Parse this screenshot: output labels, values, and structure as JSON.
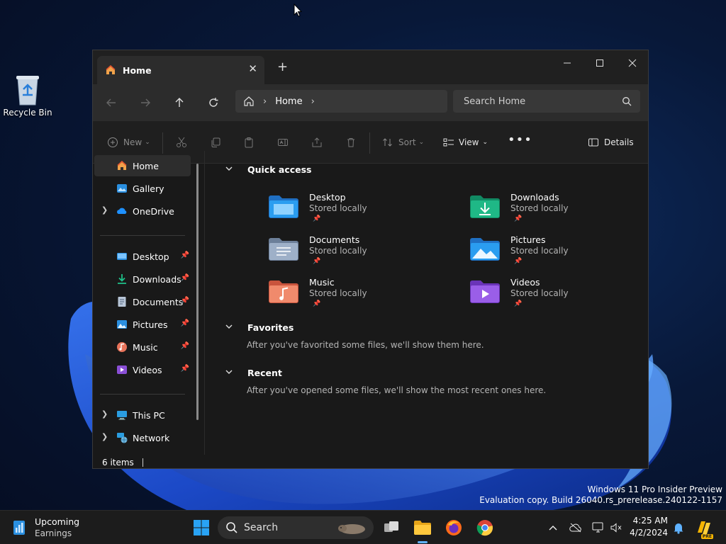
{
  "desktop": {
    "recycle_bin_label": "Recycle Bin",
    "watermark_line1": "Windows 11 Pro Insider Preview",
    "watermark_line2": "Evaluation copy. Build 26040.rs_prerelease.240122-1157"
  },
  "explorer": {
    "tab_title": "Home",
    "breadcrumb": "Home",
    "search_placeholder": "Search Home",
    "toolbar": {
      "new_label": "New",
      "sort_label": "Sort",
      "view_label": "View",
      "details_label": "Details"
    },
    "sidebar": {
      "top": [
        {
          "label": "Home",
          "icon": "home-icon"
        },
        {
          "label": "Gallery",
          "icon": "gallery-icon"
        },
        {
          "label": "OneDrive",
          "icon": "onedrive-icon"
        }
      ],
      "pinned": [
        {
          "label": "Desktop",
          "icon": "desktop-folder-icon"
        },
        {
          "label": "Downloads",
          "icon": "downloads-icon"
        },
        {
          "label": "Documents",
          "icon": "documents-icon"
        },
        {
          "label": "Pictures",
          "icon": "pictures-icon"
        },
        {
          "label": "Music",
          "icon": "music-icon"
        },
        {
          "label": "Videos",
          "icon": "videos-icon"
        }
      ],
      "bottom": [
        {
          "label": "This PC",
          "icon": "pc-icon"
        },
        {
          "label": "Network",
          "icon": "network-icon"
        }
      ]
    },
    "quick_access": {
      "title": "Quick access",
      "items": [
        {
          "name": "Desktop",
          "status": "Stored locally",
          "color": "#2a8fe0"
        },
        {
          "name": "Downloads",
          "status": "Stored locally",
          "color": "#1fa87a"
        },
        {
          "name": "Documents",
          "status": "Stored locally",
          "color": "#8497b0"
        },
        {
          "name": "Pictures",
          "status": "Stored locally",
          "color": "#2a8fe0"
        },
        {
          "name": "Music",
          "status": "Stored locally",
          "color": "#e8735a"
        },
        {
          "name": "Videos",
          "status": "Stored locally",
          "color": "#8a4fd6"
        }
      ]
    },
    "favorites": {
      "title": "Favorites",
      "empty_text": "After you've favorited some files, we'll show them here."
    },
    "recent": {
      "title": "Recent",
      "empty_text": "After you've opened some files, we'll show the most recent ones here."
    },
    "status": {
      "items_count": "6 items"
    }
  },
  "taskbar": {
    "widget_title": "Upcoming",
    "widget_subtitle": "Earnings",
    "search_label": "Search",
    "time": "4:25 AM",
    "date": "4/2/2024",
    "copilot_badge": "PRE"
  }
}
